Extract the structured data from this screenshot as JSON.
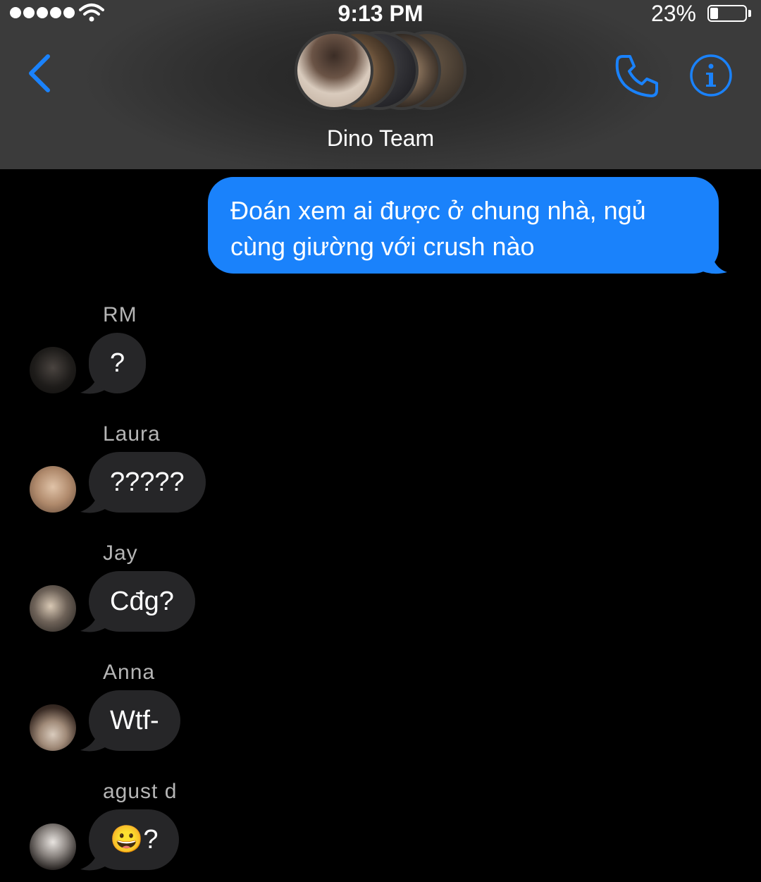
{
  "status_bar": {
    "time": "9:13 PM",
    "battery_percent": "23%",
    "battery_level": 0.23,
    "signal_bars": 5,
    "icons": [
      "signal-dots-icon",
      "wifi-icon",
      "battery-icon"
    ]
  },
  "header": {
    "group_name": "Dino Team",
    "accent_color": "#1a82fb",
    "icons": [
      "chevron-left-icon",
      "phone-icon",
      "info-icon"
    ]
  },
  "messages": {
    "sent": {
      "text": "Đoán xem ai được ở chung nhà, ngủ cùng giường với crush nào",
      "bubble_color": "#1a82fb"
    },
    "received": [
      {
        "sender": "RM",
        "text": "?"
      },
      {
        "sender": "Laura",
        "text": "?????"
      },
      {
        "sender": "Jay",
        "text": "Cđg?"
      },
      {
        "sender": "Anna",
        "text": "Wtf-"
      },
      {
        "sender": "agust d",
        "text": "😀?"
      }
    ],
    "received_bubble_color": "#262628"
  }
}
